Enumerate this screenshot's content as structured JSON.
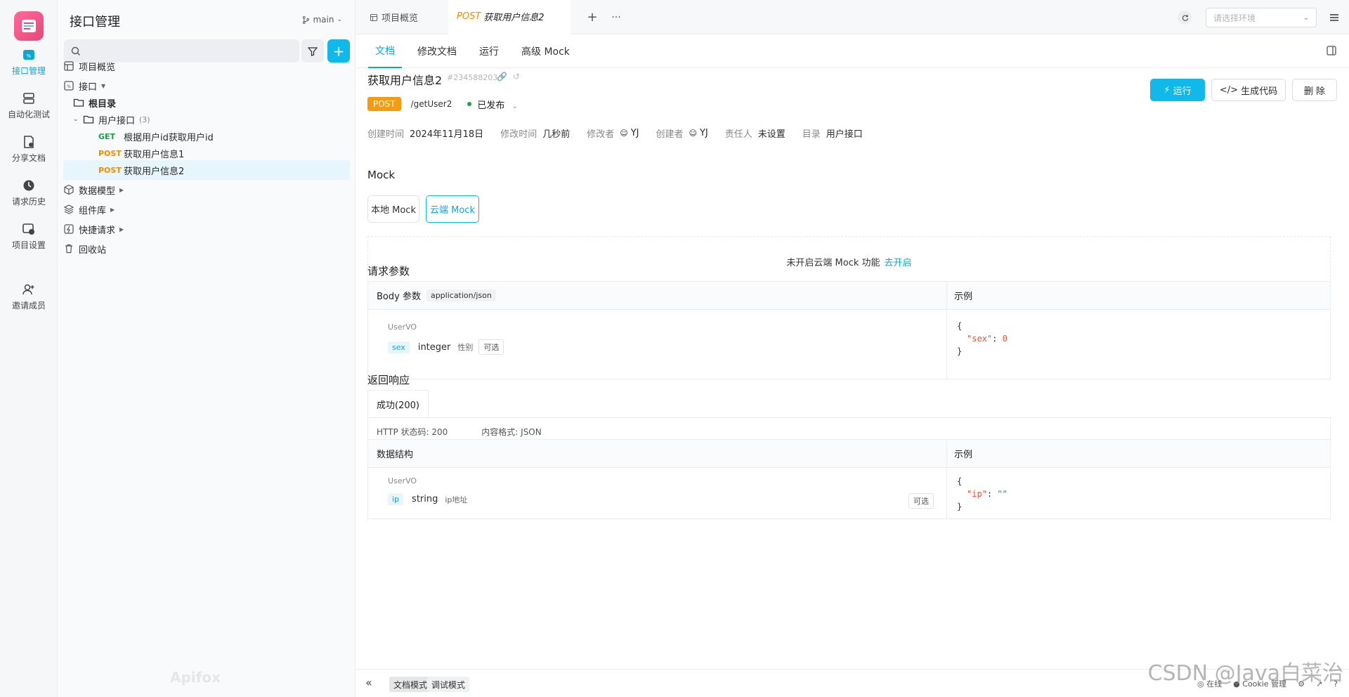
{
  "rail": {
    "items": [
      {
        "label": "接口管理",
        "icon": "api-icon",
        "active": true
      },
      {
        "label": "自动化测试",
        "icon": "automation-icon"
      },
      {
        "label": "分享文档",
        "icon": "share-doc-icon"
      },
      {
        "label": "请求历史",
        "icon": "history-icon"
      },
      {
        "label": "项目设置",
        "icon": "settings-icon"
      },
      {
        "label": "邀请成员",
        "icon": "invite-member-icon"
      }
    ]
  },
  "sidebar": {
    "title": "接口管理",
    "branch": "main",
    "search_placeholder": "",
    "tree": {
      "overview": "项目概览",
      "interface": "接口",
      "root": "根目录",
      "folder": "用户接口",
      "folder_count": "(3)",
      "endpoints": [
        {
          "method": "GET",
          "name": "根据用户id获取用户id"
        },
        {
          "method": "POST",
          "name": "获取用户信息1"
        },
        {
          "method": "POST",
          "name": "获取用户信息2"
        }
      ],
      "data_model": "数据模型",
      "components": "组件库",
      "quick_request": "快捷请求",
      "recycle": "回收站"
    },
    "watermark": "Apifox"
  },
  "tabs": {
    "overview": "项目概览",
    "active_method": "POST",
    "active_name": "获取用户信息2",
    "env_placeholder": "请选择环境"
  },
  "subtabs": [
    "文档",
    "修改文档",
    "运行",
    "高级 Mock"
  ],
  "doc": {
    "title": "获取用户信息2",
    "id": "#234588203",
    "method": "POST",
    "path": "/getUser2",
    "status": "已发布",
    "buttons": {
      "run": "运行",
      "gen_code": "生成代码",
      "delete": "删 除"
    },
    "info": [
      {
        "k": "创建时间",
        "v": "2024年11月18日"
      },
      {
        "k": "修改时间",
        "v": "几秒前"
      },
      {
        "k": "修改者",
        "v": "YJ"
      },
      {
        "k": "创建者",
        "v": "YJ"
      },
      {
        "k": "责任人",
        "v": "未设置"
      },
      {
        "k": "目录",
        "v": "用户接口"
      }
    ]
  },
  "mock": {
    "title": "Mock",
    "local": "本地 Mock",
    "cloud": "云端 Mock",
    "notice": "未开启云端 Mock 功能",
    "enable_link": "去开启"
  },
  "request": {
    "title": "请求参数",
    "body_label": "Body 参数",
    "content_type": "application/json",
    "example_label": "示例",
    "schema": "UserVO",
    "field": {
      "name": "sex",
      "type": "integer",
      "desc": "性别",
      "optional": "可选"
    },
    "example": {
      "open": "{",
      "key": "\"sex\"",
      "colon": ": ",
      "value": "0",
      "close": "}"
    }
  },
  "response": {
    "title": "返回响应",
    "tab": "成功(200)",
    "http_status": "HTTP 状态码: 200",
    "format": "内容格式: JSON",
    "struct_label": "数据结构",
    "example_label": "示例",
    "schema": "UserVO",
    "field": {
      "name": "ip",
      "type": "string",
      "desc": "ip地址",
      "optional": "可选"
    },
    "example": {
      "open": "{",
      "key": "\"ip\"",
      "colon": ": ",
      "value": "\"\"",
      "close": "}"
    }
  },
  "bottom": {
    "doc_mode": "文档模式",
    "debug_mode": "调试模式",
    "online": "在线",
    "cookie": "Cookie 管理"
  },
  "overlay": "CSDN @Java白菜治"
}
